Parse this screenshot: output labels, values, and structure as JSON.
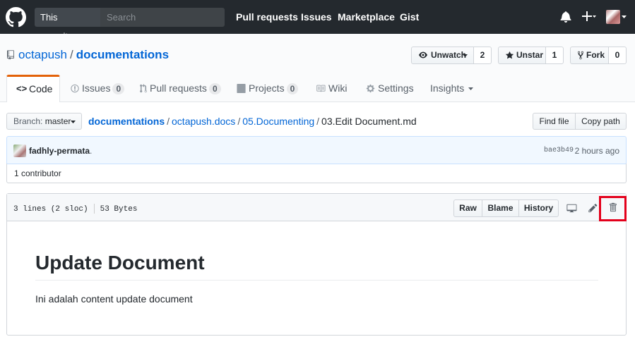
{
  "header": {
    "scope_label": "This repository",
    "search_placeholder": "Search",
    "nav": [
      "Pull requests",
      "Issues",
      "Marketplace",
      "Gist"
    ],
    "new_icon": "plus-icon",
    "bell_icon": "bell-icon"
  },
  "repo": {
    "owner": "octapush",
    "separator": "/",
    "name": "documentations",
    "watch_label": "Unwatch",
    "watch_count": "2",
    "star_label": "Unstar",
    "star_count": "1",
    "fork_label": "Fork",
    "fork_count": "0"
  },
  "tabs": [
    {
      "label": "Code"
    },
    {
      "label": "Issues",
      "count": "0"
    },
    {
      "label": "Pull requests",
      "count": "0"
    },
    {
      "label": "Projects",
      "count": "0"
    },
    {
      "label": "Wiki"
    },
    {
      "label": "Settings"
    },
    {
      "label": "Insights"
    }
  ],
  "breadcrumb": {
    "branch_prefix": "Branch:",
    "branch": "master",
    "parts": [
      "documentations",
      "octapush.docs",
      "05.Documenting"
    ],
    "file": "03.Edit Document.md",
    "sep": "/",
    "find_file": "Find file",
    "copy_path": "Copy path"
  },
  "commit": {
    "author": "fadhly-permata",
    "message": ".",
    "sha": "bae3b49",
    "time": "2 hours ago",
    "contributors": "1 contributor"
  },
  "file": {
    "lines": "3 lines (2 sloc)",
    "size": "53 Bytes",
    "raw": "Raw",
    "blame": "Blame",
    "history": "History",
    "heading": "Update Document",
    "body": "Ini adalah content update document"
  },
  "colors": {
    "header_bg": "#24292e",
    "link": "#0366d6",
    "tab_accent": "#e36209",
    "highlight": "#e3001b"
  }
}
